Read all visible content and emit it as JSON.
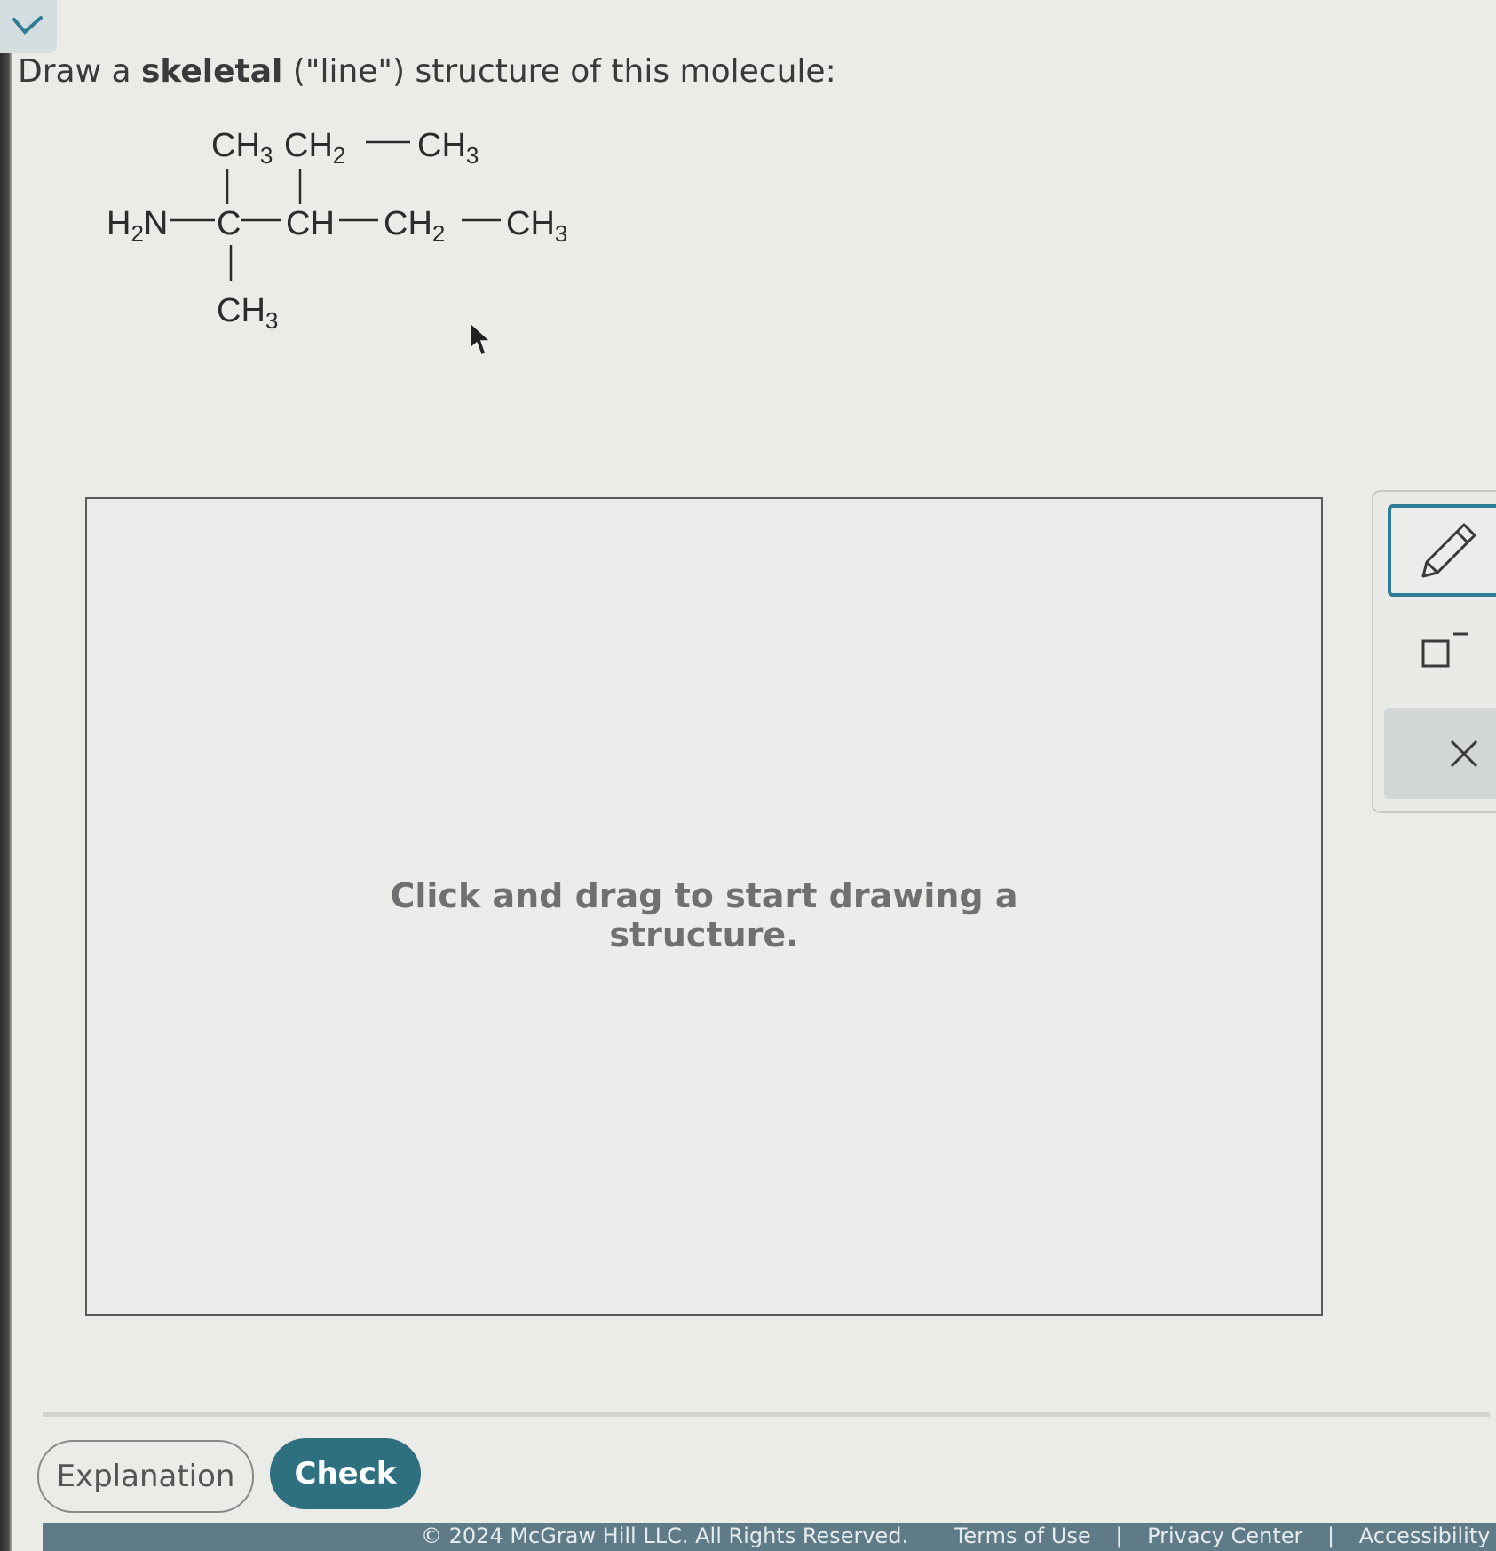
{
  "question": {
    "prefix": "Draw a ",
    "bold": "skeletal",
    "suffix": " (\"line\") structure of this molecule:"
  },
  "molecule": {
    "labels": {
      "h2n": "H",
      "h2n_sub": "2",
      "h2n_tail": "N",
      "c": "C",
      "ch": "CH",
      "ch2_main": "CH",
      "ch2_main_sub": "2",
      "ch3_end": "CH",
      "ch3_end_sub": "3",
      "ch3_top": "CH",
      "ch3_top_sub": "3",
      "ch2_top": "CH",
      "ch2_top_sub": "2",
      "ch3_top_right": "CH",
      "ch3_top_right_sub": "3",
      "ch3_bottom": "CH",
      "ch3_bottom_sub": "3"
    }
  },
  "canvas": {
    "hint_line1": "Click and drag to start drawing a",
    "hint_line2": "structure."
  },
  "toolbar": {
    "tools": [
      "pencil-icon",
      "charge-icon",
      "close-icon"
    ],
    "accent": "#2e7d94"
  },
  "actions": {
    "explanation_label": "Explanation",
    "check_label": "Check",
    "check_color": "#2e6f80"
  },
  "footer": {
    "copyright": "© 2024 McGraw Hill LLC. All Rights Reserved.",
    "terms": "Terms of Use",
    "privacy": "Privacy Center",
    "accessibility": "Accessibility",
    "separator": "|"
  }
}
